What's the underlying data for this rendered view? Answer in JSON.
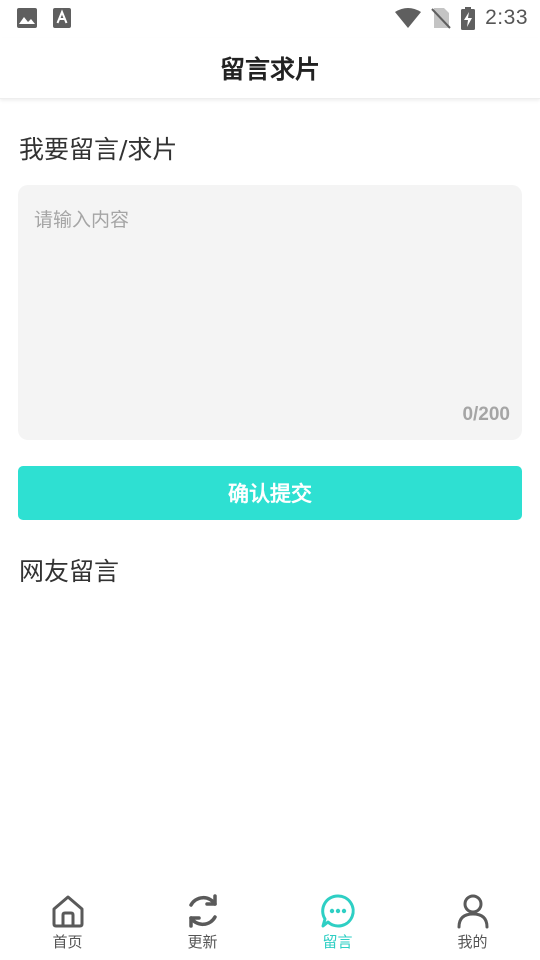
{
  "status_bar": {
    "time": "2:33",
    "icons": [
      "image-icon",
      "a-text-icon",
      "wifi-icon",
      "no-sim-icon",
      "battery-charging-icon"
    ]
  },
  "header": {
    "title": "留言求片"
  },
  "form": {
    "section_title": "我要留言/求片",
    "input_placeholder": "请输入内容",
    "input_value": "",
    "char_count": "0/200",
    "submit_label": "确认提交"
  },
  "comments": {
    "section_title": "网友留言"
  },
  "bottom_nav": {
    "items": [
      {
        "label": "首页",
        "icon": "home-icon",
        "active": false
      },
      {
        "label": "更新",
        "icon": "refresh-icon",
        "active": false
      },
      {
        "label": "留言",
        "icon": "chat-bubble-icon",
        "active": true
      },
      {
        "label": "我的",
        "icon": "user-icon",
        "active": false
      }
    ]
  },
  "colors": {
    "accent": "#2ee0d2",
    "active_nav": "#2ecfc4",
    "inactive_nav": "#555555",
    "input_bg": "#f4f4f4"
  }
}
